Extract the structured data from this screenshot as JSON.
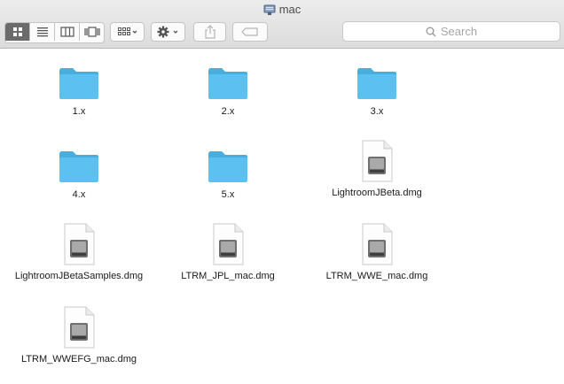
{
  "window": {
    "title": "mac"
  },
  "toolbar": {
    "view_icons": [
      "icon-view-icon",
      "list-view-icon",
      "column-view-icon",
      "coverflow-view-icon"
    ],
    "search_placeholder": "Search"
  },
  "files": [
    {
      "name": "1.x",
      "kind": "folder"
    },
    {
      "name": "2.x",
      "kind": "folder"
    },
    {
      "name": "3.x",
      "kind": "folder"
    },
    {
      "name": "4.x",
      "kind": "folder"
    },
    {
      "name": "5.x",
      "kind": "folder"
    },
    {
      "name": "LightroomJBeta.dmg",
      "kind": "dmg"
    },
    {
      "name": "LightroomJBetaSamples.dmg",
      "kind": "dmg"
    },
    {
      "name": "LTRM_JPL_mac.dmg",
      "kind": "dmg"
    },
    {
      "name": "LTRM_WWE_mac.dmg",
      "kind": "dmg"
    },
    {
      "name": "LTRM_WWEFG_mac.dmg",
      "kind": "dmg"
    }
  ],
  "colors": {
    "folder": "#5cc0f0",
    "folder_tab": "#48aede",
    "selected_segment": "#6b6b6b"
  }
}
